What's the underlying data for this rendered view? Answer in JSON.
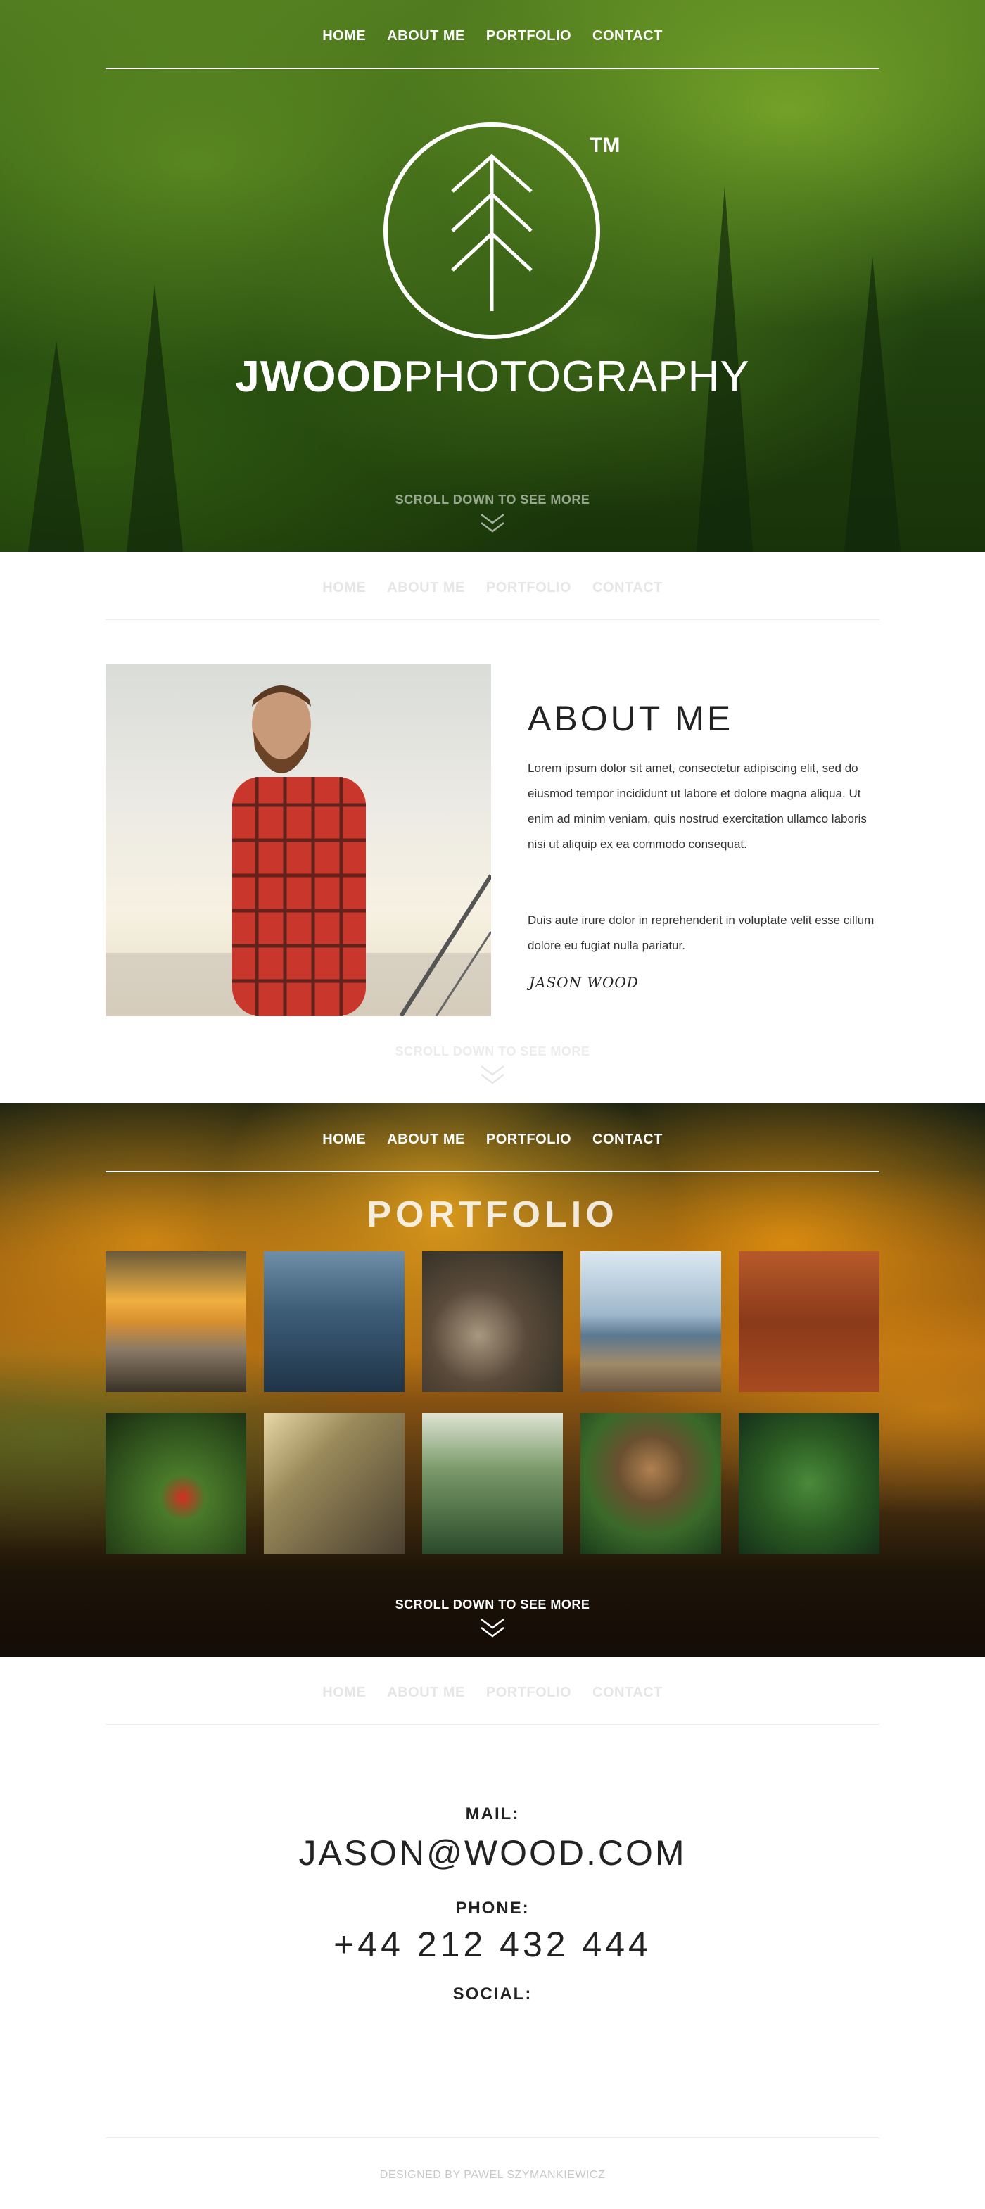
{
  "nav": {
    "items": [
      "HOME",
      "ABOUT ME",
      "PORTFOLIO",
      "CONTACT"
    ]
  },
  "hero": {
    "logo_tm": "TM",
    "brand_bold": "JWOOD",
    "brand_thin": "PHOTOGRAPHY",
    "scroll_hint": "SCROLL DOWN TO SEE MORE"
  },
  "about": {
    "heading": "ABOUT ME",
    "paragraph1": "Lorem ipsum dolor sit amet, consectetur adipiscing elit, sed do eiusmod tempor incididunt ut labore et dolore magna aliqua. Ut enim ad minim veniam, quis nostrud exercitation ullamco laboris nisi ut aliquip ex ea commodo consequat.",
    "paragraph2": "Duis aute irure dolor in reprehenderit in voluptate velit esse cillum dolore eu fugiat nulla pariatur.",
    "signature": "JASON WOOD",
    "scroll_hint": "SCROLL DOWN TO SEE MORE"
  },
  "portfolio": {
    "title": "PORTFOLIO",
    "scroll_hint": "SCROLL DOWN TO SEE MORE",
    "thumbnails": [
      {
        "subject": "sunset-fence"
      },
      {
        "subject": "misty-pines"
      },
      {
        "subject": "rocky-stream"
      },
      {
        "subject": "lake-pier"
      },
      {
        "subject": "autumn-forest-path"
      },
      {
        "subject": "red-mushroom"
      },
      {
        "subject": "bamboo-forest"
      },
      {
        "subject": "green-valley"
      },
      {
        "subject": "owl"
      },
      {
        "subject": "fern-leaves"
      }
    ]
  },
  "contact": {
    "mail_label": "MAIL:",
    "mail_value": "JASON@WOOD.COM",
    "phone_label": "PHONE:",
    "phone_value": "+44 212 432 444",
    "social_label": "SOCIAL:"
  },
  "footer": {
    "credit": "DESIGNED BY PAWEL SZYMANKIEWICZ"
  },
  "colors": {
    "text_dark": "#222222",
    "nav_faded": "#e6e6e6",
    "white": "#ffffff"
  }
}
